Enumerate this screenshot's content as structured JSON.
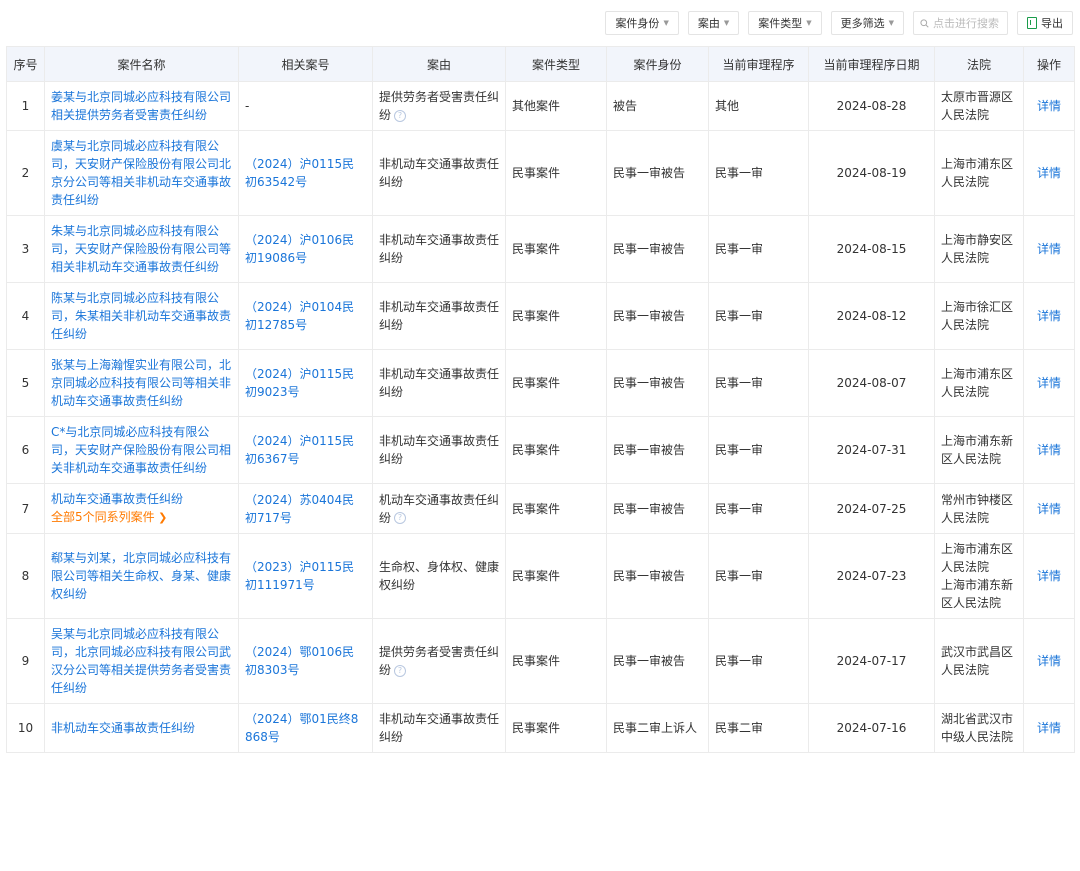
{
  "toolbar": {
    "filters": [
      {
        "label": "案件身份"
      },
      {
        "label": "案由"
      },
      {
        "label": "案件类型"
      },
      {
        "label": "更多筛选"
      }
    ],
    "search_placeholder": "点击进行搜索",
    "export_label": "导出"
  },
  "table": {
    "headers": [
      "序号",
      "案件名称",
      "相关案号",
      "案由",
      "案件类型",
      "案件身份",
      "当前审理程序",
      "当前审理程序日期",
      "法院",
      "操作"
    ],
    "rows": [
      {
        "no": "1",
        "name": "姜某与北京同城必应科技有限公司相关提供劳务者受害责任纠纷",
        "series": "",
        "case_no": "-",
        "cause": "提供劳务者受害责任纠纷",
        "cause_help": true,
        "type": "其他案件",
        "role": "被告",
        "procedure": "其他",
        "date": "2024-08-28",
        "court": [
          "太原市晋源区人民法院"
        ],
        "action": "详情"
      },
      {
        "no": "2",
        "name": "虞某与北京同城必应科技有限公司，天安财产保险股份有限公司北京分公司等相关非机动车交通事故责任纠纷",
        "series": "",
        "case_no": "（2024）沪0115民初63542号",
        "cause": "非机动车交通事故责任纠纷",
        "cause_help": false,
        "type": "民事案件",
        "role": "民事一审被告",
        "procedure": "民事一审",
        "date": "2024-08-19",
        "court": [
          "上海市浦东区人民法院"
        ],
        "action": "详情"
      },
      {
        "no": "3",
        "name": "朱某与北京同城必应科技有限公司，天安财产保险股份有限公司等相关非机动车交通事故责任纠纷",
        "series": "",
        "case_no": "（2024）沪0106民初19086号",
        "cause": "非机动车交通事故责任纠纷",
        "cause_help": false,
        "type": "民事案件",
        "role": "民事一审被告",
        "procedure": "民事一审",
        "date": "2024-08-15",
        "court": [
          "上海市静安区人民法院"
        ],
        "action": "详情"
      },
      {
        "no": "4",
        "name": "陈某与北京同城必应科技有限公司，朱某相关非机动车交通事故责任纠纷",
        "series": "",
        "case_no": "（2024）沪0104民初12785号",
        "cause": "非机动车交通事故责任纠纷",
        "cause_help": false,
        "type": "民事案件",
        "role": "民事一审被告",
        "procedure": "民事一审",
        "date": "2024-08-12",
        "court": [
          "上海市徐汇区人民法院"
        ],
        "action": "详情"
      },
      {
        "no": "5",
        "name": "张某与上海瀚惺实业有限公司，北京同城必应科技有限公司等相关非机动车交通事故责任纠纷",
        "series": "",
        "case_no": "（2024）沪0115民初9023号",
        "cause": "非机动车交通事故责任纠纷",
        "cause_help": false,
        "type": "民事案件",
        "role": "民事一审被告",
        "procedure": "民事一审",
        "date": "2024-08-07",
        "court": [
          "上海市浦东区人民法院"
        ],
        "action": "详情"
      },
      {
        "no": "6",
        "name": "C*与北京同城必应科技有限公司，天安财产保险股份有限公司相关非机动车交通事故责任纠纷",
        "series": "",
        "case_no": "（2024）沪0115民初6367号",
        "cause": "非机动车交通事故责任纠纷",
        "cause_help": false,
        "type": "民事案件",
        "role": "民事一审被告",
        "procedure": "民事一审",
        "date": "2024-07-31",
        "court": [
          "上海市浦东新区人民法院"
        ],
        "action": "详情"
      },
      {
        "no": "7",
        "name": "机动车交通事故责任纠纷",
        "series": "全部5个同系列案件",
        "case_no": "（2024）苏0404民初717号",
        "cause": "机动车交通事故责任纠纷",
        "cause_help": true,
        "type": "民事案件",
        "role": "民事一审被告",
        "procedure": "民事一审",
        "date": "2024-07-25",
        "court": [
          "常州市钟楼区人民法院"
        ],
        "action": "详情"
      },
      {
        "no": "8",
        "name": "郗某与刘某，北京同城必应科技有限公司等相关生命权、身某、健康权纠纷",
        "series": "",
        "case_no": "（2023）沪0115民初111971号",
        "cause": "生命权、身体权、健康权纠纷",
        "cause_help": false,
        "type": "民事案件",
        "role": "民事一审被告",
        "procedure": "民事一审",
        "date": "2024-07-23",
        "court": [
          "上海市浦东区人民法院",
          "上海市浦东新区人民法院"
        ],
        "action": "详情"
      },
      {
        "no": "9",
        "name": "吴某与北京同城必应科技有限公司，北京同城必应科技有限公司武汉分公司等相关提供劳务者受害责任纠纷",
        "series": "",
        "case_no": "（2024）鄂0106民初8303号",
        "cause": "提供劳务者受害责任纠纷",
        "cause_help": true,
        "type": "民事案件",
        "role": "民事一审被告",
        "procedure": "民事一审",
        "date": "2024-07-17",
        "court": [
          "武汉市武昌区人民法院"
        ],
        "action": "详情"
      },
      {
        "no": "10",
        "name": "非机动车交通事故责任纠纷",
        "series": "",
        "case_no": "（2024）鄂01民终8868号",
        "cause": "非机动车交通事故责任纠纷",
        "cause_help": false,
        "type": "民事案件",
        "role": "民事二审上诉人",
        "procedure": "民事二审",
        "date": "2024-07-16",
        "court": [
          "湖北省武汉市中级人民法院"
        ],
        "action": "详情"
      }
    ]
  }
}
